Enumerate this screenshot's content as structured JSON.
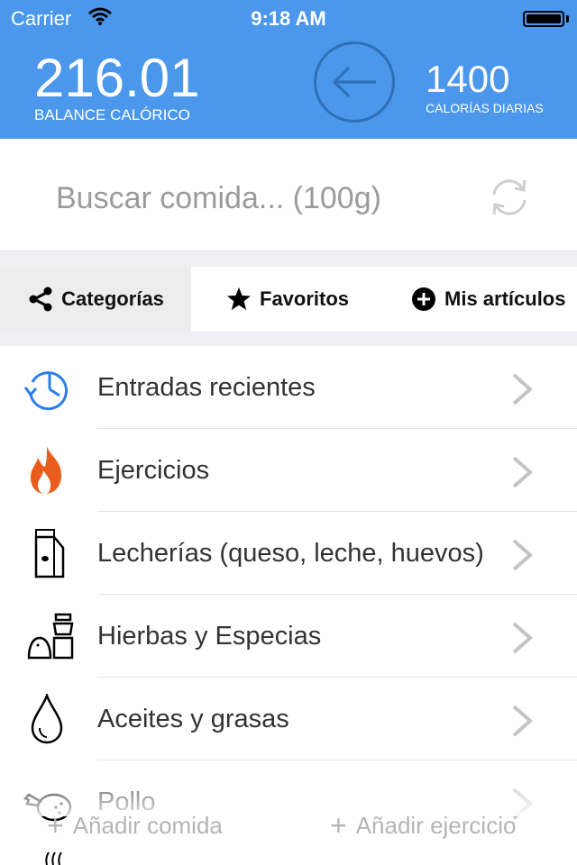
{
  "status_bar": {
    "carrier": "Carrier",
    "time": "9:18 AM"
  },
  "header": {
    "balance_value": "216.01",
    "balance_label": "BALANCE CALÓRICO",
    "daily_value": "1400",
    "daily_label": "CALORÍAS DIARIAS",
    "color": "#4a97ec"
  },
  "search": {
    "placeholder": "Buscar comida... (100g)"
  },
  "tabs": [
    {
      "label": "Categorías",
      "icon": "share-icon",
      "active": true
    },
    {
      "label": "Favoritos",
      "icon": "star-icon",
      "active": false
    },
    {
      "label": "Mis artículos",
      "icon": "plus-circle-icon",
      "active": false
    }
  ],
  "categories": [
    {
      "label": "Entradas recientes",
      "icon": "clock-icon"
    },
    {
      "label": "Ejercicios",
      "icon": "flame-icon"
    },
    {
      "label": "Lecherías (queso, leche, huevos)",
      "icon": "milk-carton-icon"
    },
    {
      "label": "Hierbas y Especias",
      "icon": "spice-shaker-icon"
    },
    {
      "label": "Aceites y grasas",
      "icon": "oil-drop-icon"
    },
    {
      "label": "Pollo",
      "icon": "chicken-icon"
    }
  ],
  "actions": {
    "add_food": "Añadir comida",
    "add_exercise": "Añadir ejercicio"
  }
}
